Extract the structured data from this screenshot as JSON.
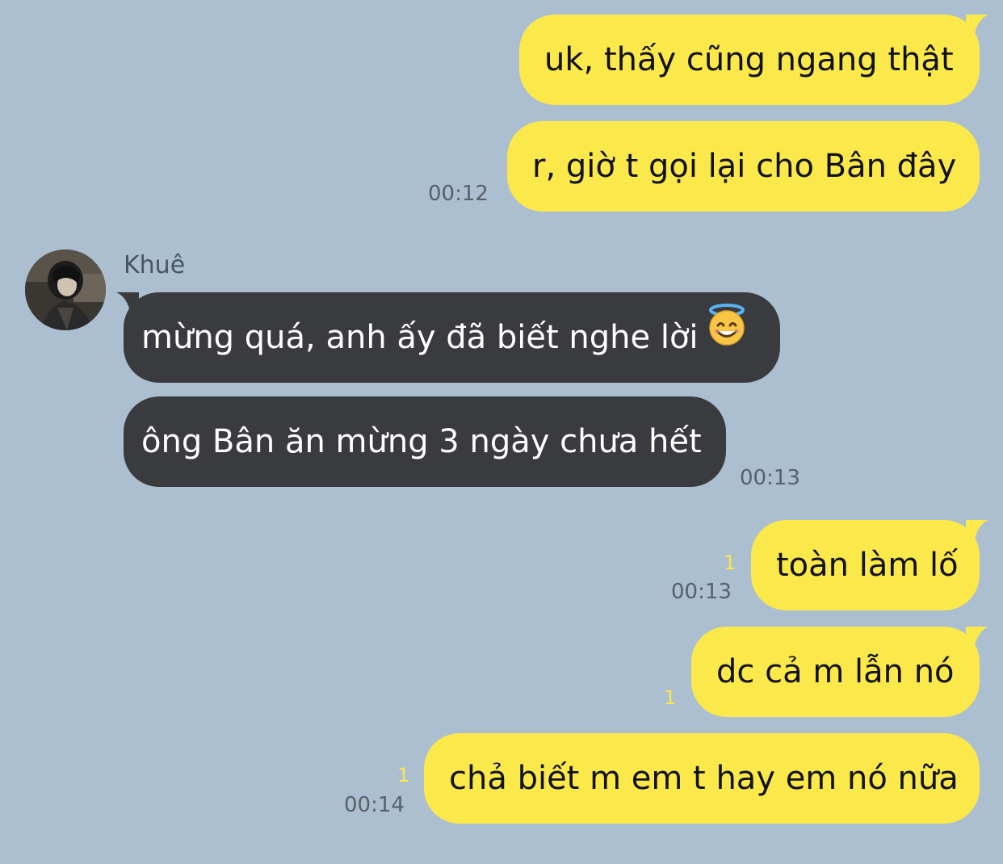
{
  "chat": {
    "contact_name": "Khuê",
    "messages": [
      {
        "side": "out",
        "text": "uk, thấy cũng ngang thật"
      },
      {
        "side": "out",
        "text": "r, giờ t gọi lại cho Bân đây",
        "time": "00:12"
      },
      {
        "side": "in",
        "text": "mừng quá, anh ấy đã biết nghe lời",
        "emoji": "smiling-face-with-halo-icon"
      },
      {
        "side": "in",
        "text": "ông Bân ăn mừng 3 ngày chưa hết",
        "time": "00:13"
      },
      {
        "side": "out",
        "text": "toàn làm lố",
        "time": "00:13",
        "unread": "1"
      },
      {
        "side": "out",
        "text": "dc cả m lẫn nó",
        "unread": "1"
      },
      {
        "side": "out",
        "text": "chả biết m em t hay em nó nữa",
        "time": "00:14",
        "unread": "1"
      }
    ]
  },
  "colors": {
    "background": "#abbfd0",
    "outgoing_bubble": "#fbe84b",
    "incoming_bubble": "#3a3b3e",
    "timestamp": "#58606a",
    "unread_count": "#fbe84b"
  }
}
